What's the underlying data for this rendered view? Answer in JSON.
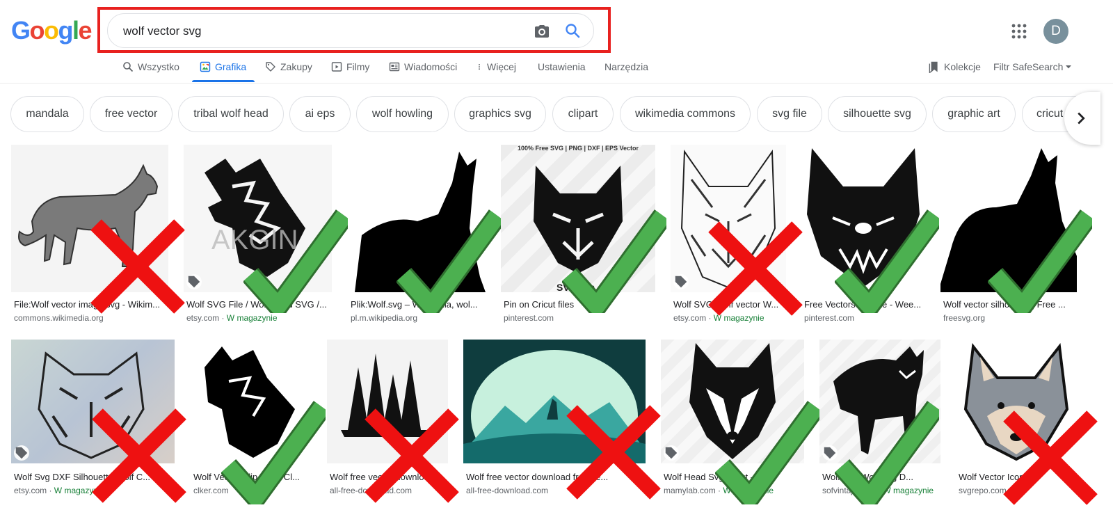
{
  "logo": [
    "G",
    "o",
    "o",
    "g",
    "l",
    "e"
  ],
  "search": {
    "query": "wolf vector svg"
  },
  "user": {
    "avatar_letter": "D"
  },
  "nav": {
    "tabs": [
      {
        "label": "Wszystko",
        "icon": "search-icon"
      },
      {
        "label": "Grafika",
        "icon": "image-icon",
        "active": true
      },
      {
        "label": "Zakupy",
        "icon": "tag-icon"
      },
      {
        "label": "Filmy",
        "icon": "play-icon"
      },
      {
        "label": "Wiadomości",
        "icon": "news-icon"
      },
      {
        "label": "Więcej",
        "icon": "more-vert-icon"
      }
    ],
    "settings": "Ustawienia",
    "tools": "Narzędzia",
    "collections": "Kolekcje",
    "safesearch": "Filtr SafeSearch"
  },
  "chips": [
    "mandala",
    "free vector",
    "tribal wolf head",
    "ai eps",
    "wolf howling",
    "graphics svg",
    "clipart",
    "wikimedia commons",
    "svg file",
    "silhouette svg",
    "graphic art",
    "cricut"
  ],
  "results_row1": [
    {
      "title": "File:Wolf vector image.svg - Wikim...",
      "source": "commons.wikimedia.org",
      "stock": "",
      "mark": "cross"
    },
    {
      "title": "Wolf SVG File / Wolf Head SVG /...",
      "source": "etsy.com",
      "stock": "W magazynie",
      "mark": "check"
    },
    {
      "title": "Plik:Wolf.svg – Wikipedia, wol...",
      "source": "pl.m.wikipedia.org",
      "stock": "",
      "mark": "check"
    },
    {
      "title": "Pin on Cricut files",
      "source": "pinterest.com",
      "stock": "",
      "mark": "check"
    },
    {
      "title": "Wolf SVG Wolf vector W...",
      "source": "etsy.com",
      "stock": "W magazynie",
      "mark": "cross"
    },
    {
      "title": "Free Vectors Update - Wee...",
      "source": "pinterest.com",
      "stock": "",
      "mark": "check"
    },
    {
      "title": "Wolf vector silhouette | Free ...",
      "source": "freesvg.org",
      "stock": "",
      "mark": "check"
    }
  ],
  "results_row2": [
    {
      "title": "Wolf Svg DXF Silhouette Wolf C...",
      "source": "etsy.com",
      "stock": "W magazynie",
      "mark": "cross"
    },
    {
      "title": "Wolf Vector Clip Art at Cl...",
      "source": "clker.com",
      "stock": "",
      "mark": "check"
    },
    {
      "title": "Wolf free vector download",
      "source": "all-free-download.com",
      "stock": "",
      "mark": "cross"
    },
    {
      "title": "Wolf free vector download free ve...",
      "source": "all-free-download.com",
      "stock": "",
      "mark": "cross"
    },
    {
      "title": "Wolf Head Svg cricut -...",
      "source": "mamylab.com",
      "stock": "W magazynie",
      "mark": "check"
    },
    {
      "title": "Wolf Svg Wolf Svg D...",
      "source": "sofvintaje.com",
      "stock": "W magazynie",
      "mark": "check"
    },
    {
      "title": "Wolf Vector Icon (",
      "source": "svgrepo.com",
      "stock": "",
      "mark": "cross"
    }
  ],
  "thumb_texts": {
    "pinterest_banner": "100% Free SVG | PNG | DXF | EPS Vector",
    "pinterest_footer": "SVGbon",
    "watermark": "AKGIN"
  },
  "colors": {
    "accent": "#1a73e8",
    "check": "#3fa845",
    "cross": "#ee1111",
    "highlight": "#e8211f"
  }
}
